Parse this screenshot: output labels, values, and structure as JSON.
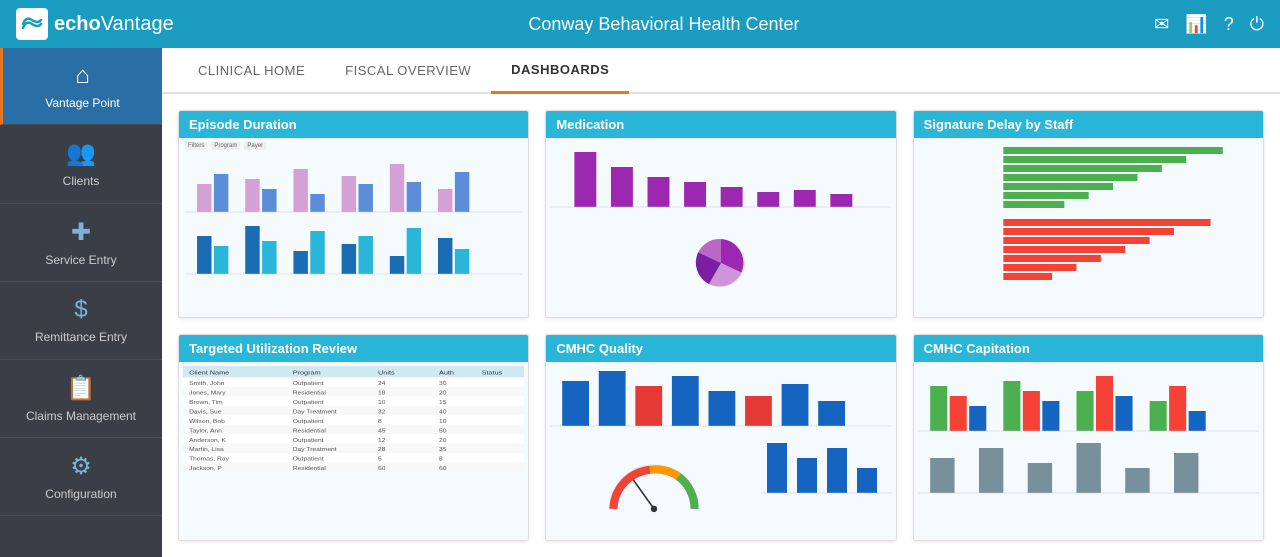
{
  "header": {
    "logo_text_start": "echo",
    "logo_text_bold": "Vantage",
    "title": "Conway Behavioral Health Center",
    "icons": [
      "mail-icon",
      "chart-icon",
      "help-icon",
      "logout-icon"
    ]
  },
  "sidebar": {
    "items": [
      {
        "id": "vantage-point",
        "label": "Vantage Point",
        "icon": "home"
      },
      {
        "id": "clients",
        "label": "Clients",
        "icon": "people"
      },
      {
        "id": "service-entry",
        "label": "Service Entry",
        "icon": "medical"
      },
      {
        "id": "remittance-entry",
        "label": "Remittance Entry",
        "icon": "dollar"
      },
      {
        "id": "claims-management",
        "label": "Claims Management",
        "icon": "clipboard"
      },
      {
        "id": "configuration",
        "label": "Configuration",
        "icon": "settings"
      }
    ]
  },
  "tabs": [
    {
      "id": "clinical-home",
      "label": "CLINICAL HOME",
      "active": false
    },
    {
      "id": "fiscal-overview",
      "label": "FISCAL OVERVIEW",
      "active": false
    },
    {
      "id": "dashboards",
      "label": "DASHBOARDS",
      "active": true
    }
  ],
  "dashboards": [
    {
      "id": "episode-duration",
      "title": "Episode Duration"
    },
    {
      "id": "medication",
      "title": "Medication"
    },
    {
      "id": "signature-delay",
      "title": "Signature Delay by Staff"
    },
    {
      "id": "targeted-utilization",
      "title": "Targeted Utilization Review"
    },
    {
      "id": "cmhc-quality",
      "title": "CMHC Quality"
    },
    {
      "id": "cmhc-capitation",
      "title": "CMHC Capitation"
    }
  ]
}
